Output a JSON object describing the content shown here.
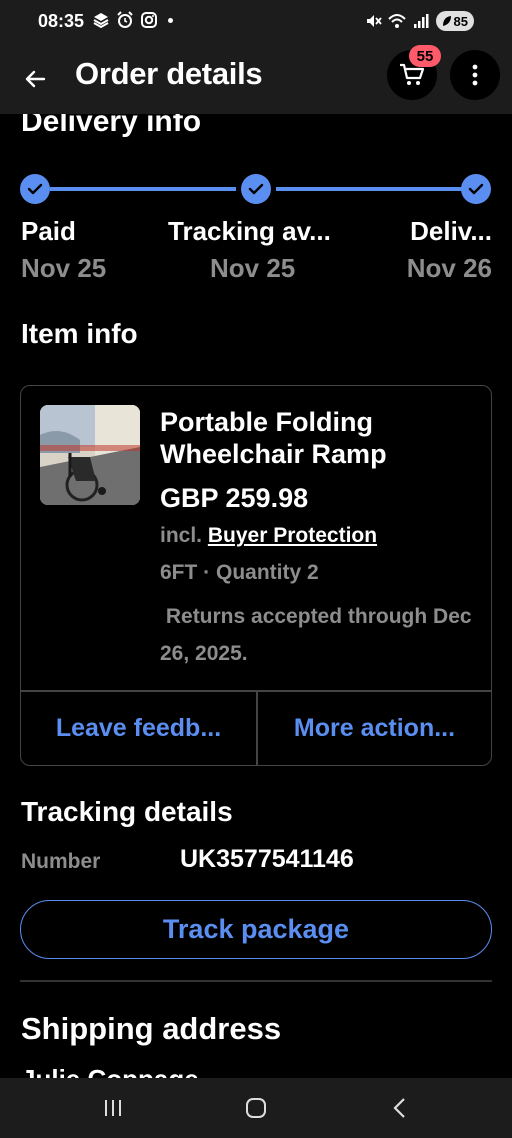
{
  "status_bar": {
    "time": "08:35",
    "battery": "85",
    "icons": [
      "stack-notification-icon",
      "alarm-icon",
      "instagram-icon",
      "mute-icon",
      "wifi-icon",
      "signal-icon"
    ]
  },
  "app_bar": {
    "title": "Order details",
    "cart_count": "55"
  },
  "delivery": {
    "title": "Delivery info",
    "steps": [
      {
        "label": "Paid",
        "date": "Nov 25"
      },
      {
        "label": "Tracking av...",
        "date": "Nov 25"
      },
      {
        "label": "Deliv...",
        "date": "Nov 26"
      }
    ]
  },
  "item_info": {
    "title": "Item info",
    "item": {
      "title": "Portable Folding Wheelchair Ramp",
      "price": "GBP 259.98",
      "protection_prefix": "incl.",
      "protection_link": "Buyer Protection",
      "variant": "6FT · Quantity 2",
      "returns": " Returns accepted through Dec 26, 2025."
    },
    "actions": {
      "feedback": "Leave feedb...",
      "more": "More action..."
    }
  },
  "tracking": {
    "title": "Tracking details",
    "number_label": "Number",
    "number_value": "UK3577541146",
    "track_button": "Track package"
  },
  "shipping": {
    "title": "Shipping address",
    "name": "Julie Coppage"
  },
  "colors": {
    "accent": "#5a8ef0",
    "badge": "#ff5a6a",
    "secondary_text": "#8d8d8d"
  }
}
